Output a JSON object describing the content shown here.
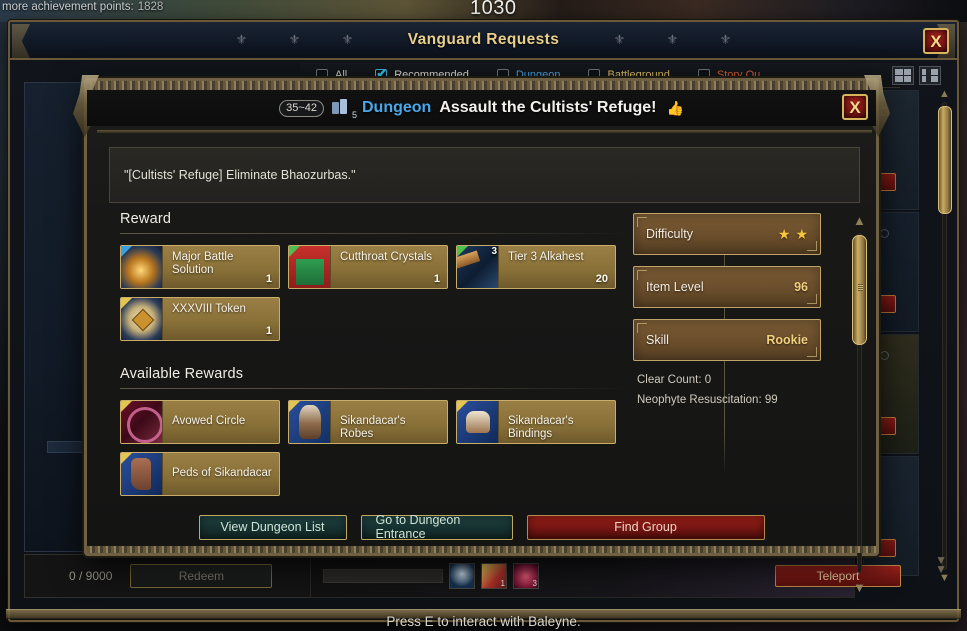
{
  "world": {
    "achievement_text": "more achievement points:",
    "achievement_points": "1828",
    "counter": "1030",
    "interact_prompt": "Press E to interact with Baleyne."
  },
  "main_window": {
    "title": "Vanguard Requests",
    "close_label": "X",
    "filters": [
      {
        "label": "All",
        "checked": false,
        "color": "#d6d2c8"
      },
      {
        "label": "Recommended",
        "checked": true,
        "color": "#e3dfd4"
      },
      {
        "label": "Dungeon",
        "checked": false,
        "color": "#4aa7e8"
      },
      {
        "label": "Battleground",
        "checked": false,
        "color": "#e0c46a"
      },
      {
        "label": "Story Qu",
        "checked": false,
        "color": "#d4643a"
      }
    ],
    "bottom": {
      "progress": "0 / 9000",
      "redeem_label": "Redeem",
      "teleport_label": "Teleport",
      "mini_icon_counts": [
        "",
        "1",
        "3"
      ]
    }
  },
  "dialog": {
    "level_range": "35~42",
    "party_size": "5",
    "type_label": "Dungeon",
    "quest_name": "Assault the Cultists' Refuge!",
    "close_label": "X",
    "description": "\"[Cultists' Refuge] Eliminate Bhaozurbas.\"",
    "reward_section_title": "Reward",
    "rewards": [
      {
        "name": "Major Battle Solution",
        "qty": "1",
        "art": "art-potion",
        "tag": "#3aa0e0",
        "badge": ""
      },
      {
        "name": "Cutthroat Crystals",
        "qty": "1",
        "art": "art-gift",
        "tag": "#4fbf52",
        "badge": ""
      },
      {
        "name": "Tier 3 Alkahest",
        "qty": "20",
        "art": "art-alk",
        "tag": "#4fbf52",
        "badge": "3"
      },
      {
        "name": "XXXVIII Token",
        "qty": "1",
        "art": "art-token",
        "tag": "#e3c551",
        "badge": ""
      }
    ],
    "available_section_title": "Available Rewards",
    "available_rewards": [
      {
        "name": "Avowed Circle",
        "qty": "",
        "art": "art-circle",
        "tag": "#e3c551",
        "badge": ""
      },
      {
        "name": "Sikandacar's Robes",
        "qty": "",
        "art": "art-robes",
        "tag": "#e3c551",
        "badge": ""
      },
      {
        "name": "Sikandacar's Bindings",
        "qty": "",
        "art": "art-bind",
        "tag": "#e3c551",
        "badge": ""
      },
      {
        "name": "Peds of Sikandacar",
        "qty": "",
        "art": "art-peds",
        "tag": "#e3c551",
        "badge": ""
      }
    ],
    "stats": [
      {
        "label": "Difficulty",
        "value": "",
        "stars": 2
      },
      {
        "label": "Item Level",
        "value": "96",
        "stars": 0
      },
      {
        "label": "Skill",
        "value": "Rookie",
        "stars": 0
      }
    ],
    "meta": {
      "clear_count": "Clear Count: 0",
      "resuscitation": "Neophyte Resuscitation: 99"
    },
    "buttons": {
      "view_list": "View Dungeon List",
      "go_entrance": "Go to Dungeon Entrance",
      "find_group": "Find Group"
    }
  },
  "colors": {
    "gold_border": "#c9ae6b",
    "accent_blue": "#4aa7e8",
    "danger_red": "#9a1e18",
    "panel_brown": "#7a5b34"
  }
}
